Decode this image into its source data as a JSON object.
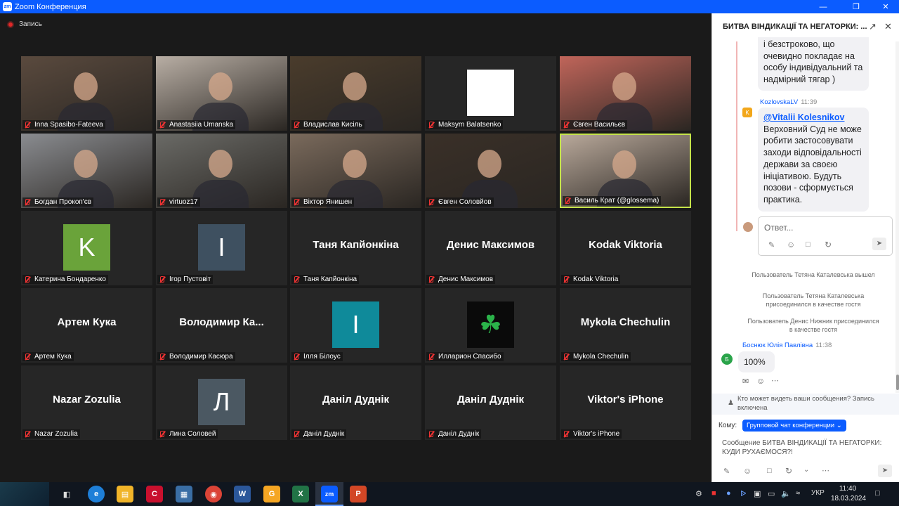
{
  "window": {
    "title": "Zoom Конференция",
    "logo": "zm"
  },
  "recording": {
    "label": "Запись"
  },
  "tiles": [
    {
      "name": "Inna Spasibo-Fateeva",
      "type": "video",
      "bg": "#5a4a3e"
    },
    {
      "name": "Anastasiia Umanska",
      "type": "video",
      "bg": "#b8aea4"
    },
    {
      "name": "Владислав Кисіль",
      "type": "video",
      "bg": "#4a3c2c"
    },
    {
      "name": "Maksym Balatsenko",
      "type": "white",
      "bg": "#262626"
    },
    {
      "name": "Євген Васильєв",
      "type": "video",
      "bg": "#c0655a"
    },
    {
      "name": "Богдан Прокоп'єв",
      "type": "video",
      "bg": "#8a8c90"
    },
    {
      "name": "virtuoz17",
      "type": "video",
      "bg": "#6a6a66"
    },
    {
      "name": "Віктор Янишен",
      "type": "video",
      "bg": "#7a6a5c"
    },
    {
      "name": "Євген Соловйов",
      "type": "video",
      "bg": "#3a3028"
    },
    {
      "name": "Василь Крат (@glossema)",
      "type": "video",
      "bg": "#b8a89a",
      "active": true
    },
    {
      "name": "Катерина Бондаренко",
      "type": "avatar",
      "letter": "K",
      "color": "#6aa33a"
    },
    {
      "name": "Ігор Пустовіт",
      "type": "avatar",
      "letter": "I",
      "color": "#3e5060"
    },
    {
      "name": "Таня Капйонкіна",
      "type": "text",
      "big": "Таня Капйонкіна"
    },
    {
      "name": "Денис Максимов",
      "type": "text",
      "big": "Денис Максимов"
    },
    {
      "name": "Kodak Viktoria",
      "type": "text",
      "big": "Kodak Viktoria"
    },
    {
      "name": "Артем Кука",
      "type": "text",
      "big": "Артем Кука"
    },
    {
      "name": "Володимир Касюра",
      "type": "text",
      "big": "Володимир  Ка..."
    },
    {
      "name": "Ілля Білоус",
      "type": "avatar",
      "letter": "I",
      "color": "#0f8a9a"
    },
    {
      "name": "Илларион Спасибо",
      "type": "clover",
      "bg": "#0a0a0a"
    },
    {
      "name": "Mykola Chechulin",
      "type": "text",
      "big": "Mykola Chechulin"
    },
    {
      "name": "Nazar Zozulia",
      "type": "text",
      "big": "Nazar Zozulia"
    },
    {
      "name": "Лина Соловей",
      "type": "avatar",
      "letter": "Л",
      "color": "#4b5862"
    },
    {
      "name": "Даніл Дуднік",
      "type": "text",
      "big": "Даніл Дуднік"
    },
    {
      "name": "Даніл Дуднік",
      "type": "text",
      "big": "Даніл Дуднік"
    },
    {
      "name": "Viktor's iPhone",
      "type": "text",
      "big": "Viktor's iPhone"
    }
  ],
  "chat": {
    "title": "БИТВА ВІНДИКАЦІЇ ТА НЕГАТОРКИ: ...",
    "prev_lines": [
      "і безстроково, що",
      "очевидно покладає на",
      "особу індивідуальний та",
      "надмірний тягар )"
    ],
    "msg1": {
      "sender": "KozlovskaLV",
      "time": "11:39",
      "avatar": "K",
      "mention": "@Vitalii Kolesnikov",
      "lines": [
        "Верховний Суд не може",
        "робити застосовувати",
        "заходи відповідальності",
        "держави  за своєю",
        "ініціативою. Будуть",
        "позови - сформується",
        "практика."
      ]
    },
    "reply_placeholder": "Ответ...",
    "sys1": "Пользователь Тетяна Каталевська вышел",
    "sys2": [
      "Пользователь Тетяна Каталевська",
      "присоединился в качестве гостя"
    ],
    "sys3": [
      "Пользователь Денис Нижник присоединился",
      "в качестве гостя"
    ],
    "msg2": {
      "sender": "Боснюк Юлія Павлівна",
      "time": "11:38",
      "avatar": "Б",
      "text": "100%"
    },
    "privacy_line1": "Кто может видеть ваши сообщения? Запись",
    "privacy_line2": "включена",
    "to_label": "Кому:",
    "to_value": "Групповой чат конференции",
    "compose_line1": "Сообщение БИТВА ВІНДИКАЦІЇ ТА НЕГАТОРКИ:",
    "compose_line2": "КУДИ РУХАЄМОСЯ?!"
  },
  "taskbar": {
    "lang": "УКР",
    "time": "11:40",
    "date": "18.03.2024"
  }
}
